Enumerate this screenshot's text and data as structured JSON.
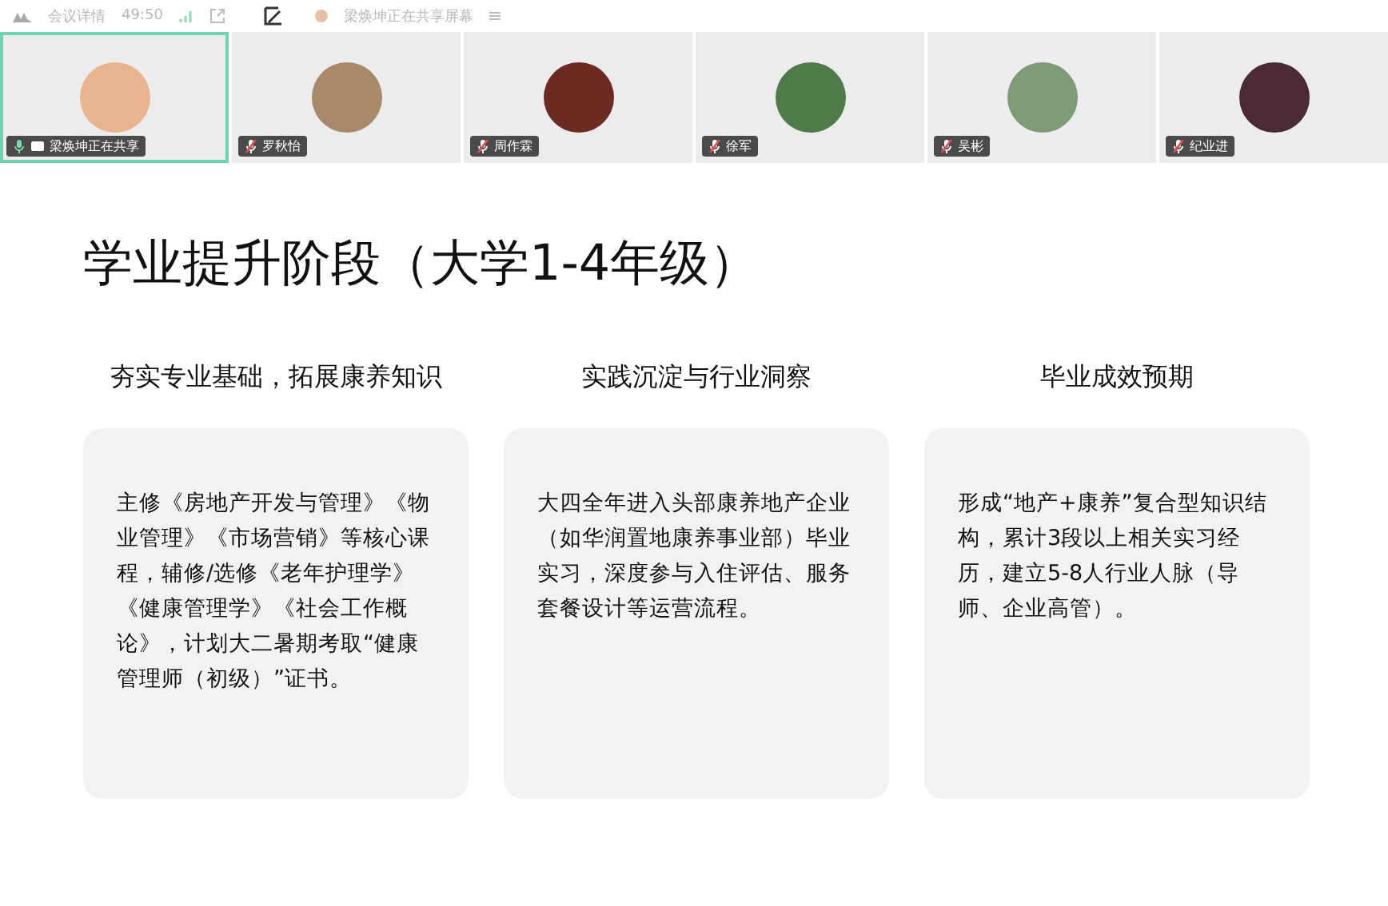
{
  "top_bar": {
    "meeting_info": "会议详情",
    "timer": "49:50",
    "sharing_status": "梁焕坤正在共享屏幕"
  },
  "participants": [
    {
      "name": "梁焕坤正在共享",
      "selected": true,
      "muted": false,
      "sharing": true,
      "color": "#e8b48e"
    },
    {
      "name": "罗秋怡",
      "selected": false,
      "muted": true,
      "sharing": false,
      "color": "#a88a6a"
    },
    {
      "name": "周作霖",
      "selected": false,
      "muted": true,
      "sharing": false,
      "color": "#6b2a22"
    },
    {
      "name": "徐军",
      "selected": false,
      "muted": true,
      "sharing": false,
      "color": "#4f7a4a"
    },
    {
      "name": "吴彬",
      "selected": false,
      "muted": true,
      "sharing": false,
      "color": "#7f9a76"
    },
    {
      "name": "纪业进",
      "selected": false,
      "muted": true,
      "sharing": false,
      "color": "#4a2a34"
    }
  ],
  "slide": {
    "title": "学业提升阶段（大学1-4年级）",
    "columns": [
      {
        "heading": "夯实专业基础，拓展康养知识",
        "body": "主修《房地产开发与管理》《物业管理》《市场营销》等核心课程，辅修/选修《老年护理学》《健康管理学》《社会工作概论》，计划大二暑期考取“健康管理师（初级）”证书。"
      },
      {
        "heading": "实践沉淀与行业洞察",
        "body": "大四全年进入头部康养地产企业（如华润置地康养事业部）毕业实习，深度参与入住评估、服务套餐设计等运营流程。"
      },
      {
        "heading": "毕业成效预期",
        "body": "形成“地产+康养”复合型知识结构，累计3段以上相关实习经历，建立5-8人行业人脉（导师、企业高管）。"
      }
    ]
  }
}
